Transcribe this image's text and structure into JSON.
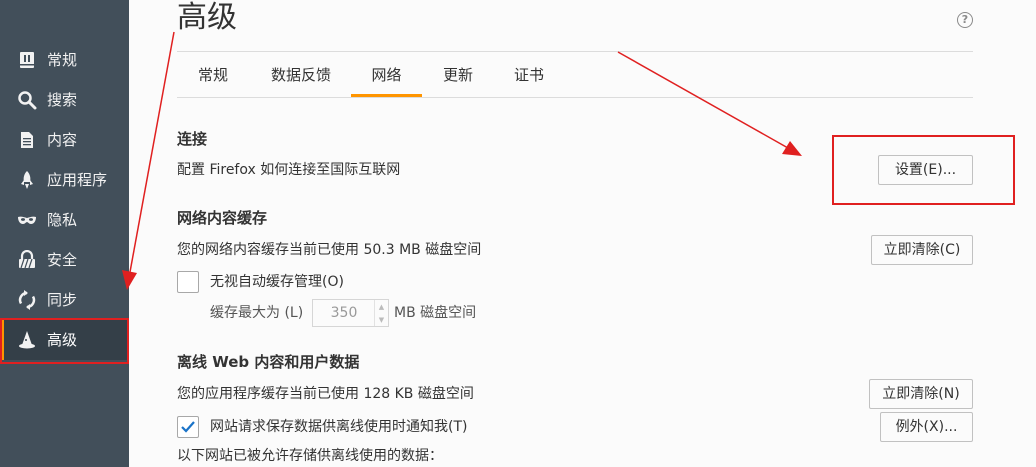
{
  "sidebar": {
    "items": [
      {
        "label": "常规",
        "icon": "general-icon"
      },
      {
        "label": "搜索",
        "icon": "search-icon"
      },
      {
        "label": "内容",
        "icon": "document-icon"
      },
      {
        "label": "应用程序",
        "icon": "rocket-icon"
      },
      {
        "label": "隐私",
        "icon": "mask-icon"
      },
      {
        "label": "安全",
        "icon": "lock-icon"
      },
      {
        "label": "同步",
        "icon": "sync-icon"
      },
      {
        "label": "高级",
        "icon": "wizard-hat-icon"
      }
    ],
    "selected": "高级"
  },
  "header": {
    "title": "高级",
    "help": "?"
  },
  "tabs": [
    {
      "label": "常规"
    },
    {
      "label": "数据反馈"
    },
    {
      "label": "网络",
      "active": true
    },
    {
      "label": "更新"
    },
    {
      "label": "证书"
    }
  ],
  "connection": {
    "heading": "连接",
    "description": "配置 Firefox 如何连接至国际互联网",
    "settings_button": "设置(E)..."
  },
  "cache": {
    "heading": "网络内容缓存",
    "usage": "您的网络内容缓存当前已使用 50.3 MB 磁盘空间",
    "clear_button": "立即清除(C)",
    "override_label": "无视自动缓存管理(O)",
    "override_checked": false,
    "limit_prefix": "缓存最大为 (L)",
    "limit_value": "350",
    "limit_suffix": "MB 磁盘空间"
  },
  "offline": {
    "heading": "离线 Web 内容和用户数据",
    "usage": "您的应用程序缓存当前已使用 128 KB 磁盘空间",
    "clear_button": "立即清除(N)",
    "notify_label": "网站请求保存数据供离线使用时通知我(T)",
    "notify_checked": true,
    "exceptions_button": "例外(X)...",
    "allowed_label": "以下网站已被允许存储供离线使用的数据："
  },
  "colors": {
    "sidebar": "#424f5a",
    "accent": "#ff9500",
    "annotation": "#e02020"
  }
}
